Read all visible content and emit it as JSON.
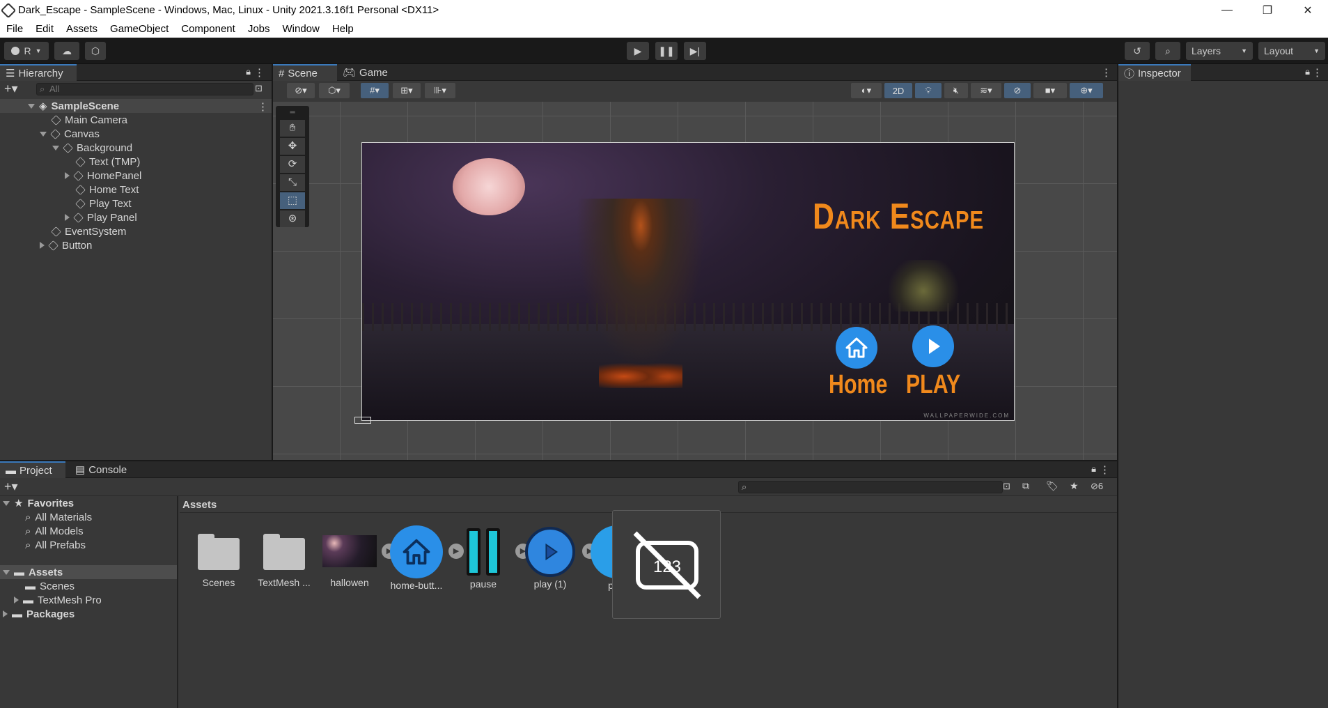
{
  "window": {
    "title": "Dark_Escape - SampleScene - Windows, Mac, Linux - Unity 2021.3.16f1 Personal <DX11>",
    "minimize": "—",
    "maximize": "❐",
    "close": "✕"
  },
  "menu": [
    "File",
    "Edit",
    "Assets",
    "GameObject",
    "Component",
    "Jobs",
    "Window",
    "Help"
  ],
  "toolbar": {
    "account_label": "R",
    "layers_label": "Layers",
    "layout_label": "Layout"
  },
  "hierarchy": {
    "tab": "Hierarchy",
    "search_placeholder": "All",
    "scene": "SampleScene",
    "items": [
      "Main Camera",
      "Canvas",
      "Background",
      "Text (TMP)",
      "HomePanel",
      "Home Text",
      "Play Text",
      "Play Panel",
      "EventSystem",
      "Button"
    ]
  },
  "scene_view": {
    "tabs": [
      "Scene",
      "Game"
    ],
    "mode_2d": "2D",
    "game_title": "Dark Escape",
    "home_label": "Home",
    "play_label": "PLAY",
    "watermark": "WALLPAPERWIDE.COM",
    "colors": {
      "title": "#f0891c",
      "button": "#2a8fe8"
    }
  },
  "inspector": {
    "tab": "Inspector"
  },
  "project": {
    "tabs": [
      "Project",
      "Console"
    ],
    "favorites_label": "Favorites",
    "favorites": [
      "All Materials",
      "All Models",
      "All Prefabs"
    ],
    "assets_root": "Assets",
    "asset_folders": [
      "Scenes",
      "TextMesh Pro"
    ],
    "packages": "Packages",
    "breadcrumb": "Assets",
    "hidden_count": "6",
    "assets": [
      "Scenes",
      "TextMesh ...",
      "hallowen",
      "home-butt...",
      "pause",
      "play (1)",
      "play"
    ]
  }
}
